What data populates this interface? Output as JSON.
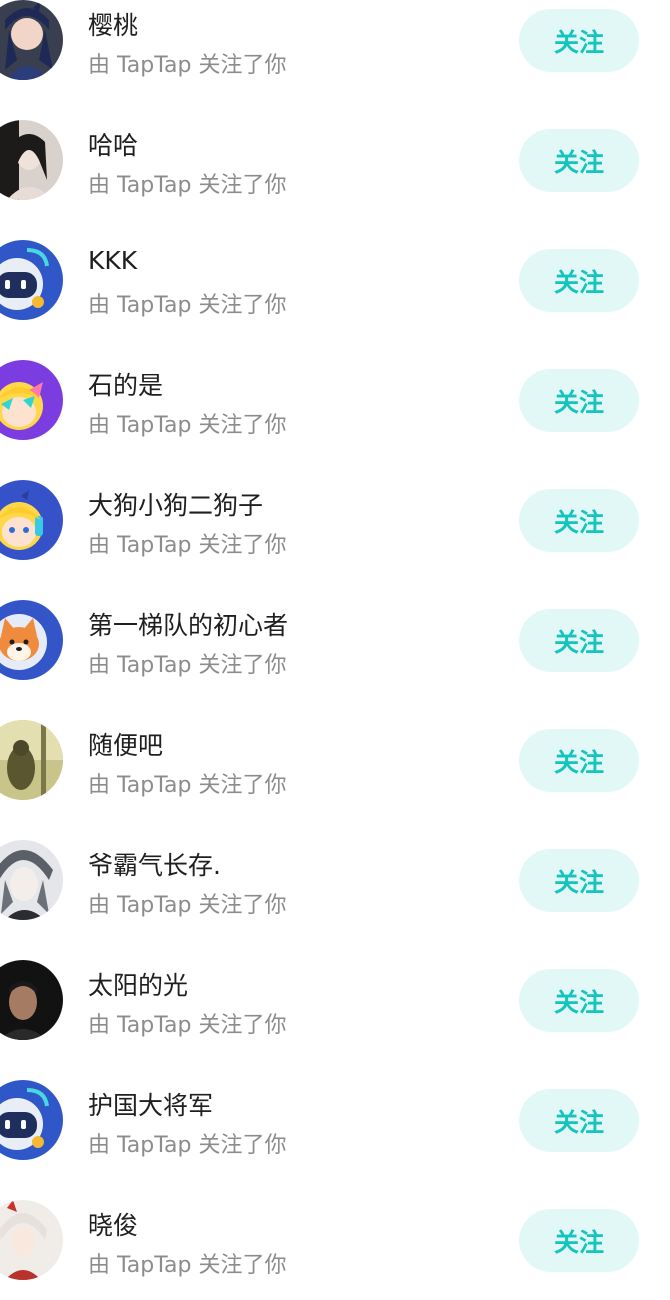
{
  "followers": [
    {
      "name": "樱桃",
      "subtitle": "由 TapTap 关注了你",
      "button": "关注",
      "avatar": "anime-girl-avatar-icon"
    },
    {
      "name": "哈哈",
      "subtitle": "由 TapTap 关注了你",
      "button": "关注",
      "avatar": "photo-girl-avatar-icon"
    },
    {
      "name": "KKK",
      "subtitle": "由 TapTap 关注了你",
      "button": "关注",
      "avatar": "robot-default-avatar-icon"
    },
    {
      "name": "石的是",
      "subtitle": "由 TapTap 关注了你",
      "button": "关注",
      "avatar": "blonde-cartoon-avatar-icon"
    },
    {
      "name": "大狗小狗二狗子",
      "subtitle": "由 TapTap 关注了你",
      "button": "关注",
      "avatar": "blonde-cartoon-avatar-icon"
    },
    {
      "name": "第一梯队的初心者",
      "subtitle": "由 TapTap 关注了你",
      "button": "关注",
      "avatar": "shiba-dog-avatar-icon"
    },
    {
      "name": "随便吧",
      "subtitle": "由 TapTap 关注了你",
      "button": "关注",
      "avatar": "forest-figure-avatar-icon"
    },
    {
      "name": "爷霸气长存.",
      "subtitle": "由 TapTap 关注了你",
      "button": "关注",
      "avatar": "grey-anime-avatar-icon"
    },
    {
      "name": "太阳的光",
      "subtitle": "由 TapTap 关注了你",
      "button": "关注",
      "avatar": "dark-photo-avatar-icon"
    },
    {
      "name": "护国大将军",
      "subtitle": "由 TapTap 关注了你",
      "button": "关注",
      "avatar": "robot-default-avatar-icon"
    },
    {
      "name": "晓俊",
      "subtitle": "由 TapTap 关注了你",
      "button": "关注",
      "avatar": "anime-warrior-avatar-icon"
    }
  ],
  "colors": {
    "accent": "#14c4bd",
    "button_bg": "#e2f8f7",
    "name_text": "#1f1f1f",
    "sub_text": "#8c8c8c"
  }
}
